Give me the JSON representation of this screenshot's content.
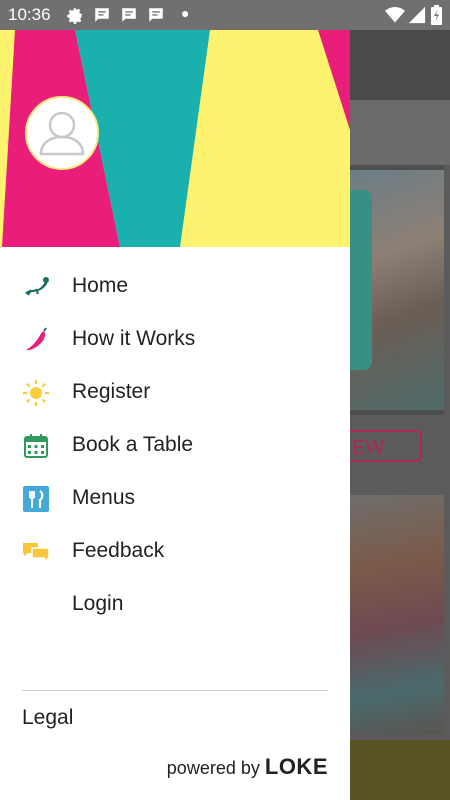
{
  "status_bar": {
    "time": "10:36",
    "icons": [
      "settings-icon",
      "message-icon",
      "message-icon",
      "message-icon",
      "dot-icon",
      "wifi-icon",
      "signal-icon",
      "battery-icon"
    ]
  },
  "drawer": {
    "header": {
      "colors": [
        "#e91e7a",
        "#19b0ae",
        "#fdf36e"
      ],
      "avatar_icon": "user-icon"
    },
    "menu_items": [
      {
        "label": "Home",
        "icon": "lizard-icon"
      },
      {
        "label": "How it Works",
        "icon": "chili-icon"
      },
      {
        "label": "Register",
        "icon": "sun-icon"
      },
      {
        "label": "Book a Table",
        "icon": "calendar-icon"
      },
      {
        "label": "Menus",
        "icon": "fork-knife-icon"
      },
      {
        "label": "Feedback",
        "icon": "chat-bubbles-icon"
      },
      {
        "label": "Login",
        "icon": ""
      }
    ],
    "legal_label": "Legal",
    "powered_by_label": "powered by",
    "brand": "LOKE"
  },
  "background": {
    "view_button_label": "EW"
  }
}
